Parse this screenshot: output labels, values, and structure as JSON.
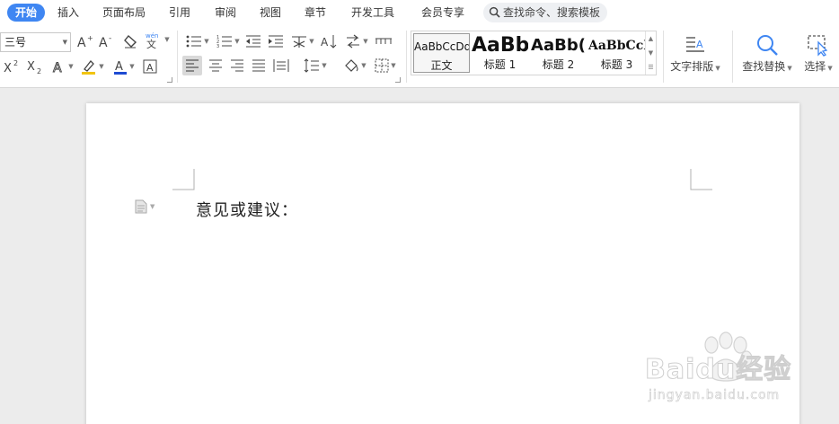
{
  "tabs": [
    {
      "label": "开始",
      "active": true
    },
    {
      "label": "插入"
    },
    {
      "label": "页面布局"
    },
    {
      "label": "引用"
    },
    {
      "label": "审阅"
    },
    {
      "label": "视图"
    },
    {
      "label": "章节"
    },
    {
      "label": "开发工具"
    },
    {
      "label": "会员专享"
    }
  ],
  "search": {
    "label": "查找命令、搜索模板"
  },
  "font": {
    "size": "三号"
  },
  "styles": [
    {
      "sample": "AaBbCcDd",
      "name": "正文",
      "selected": true
    },
    {
      "sample": "AaBb",
      "name": "标题 1"
    },
    {
      "sample": "AaBb(",
      "name": "标题 2"
    },
    {
      "sample": "AaBbCcI",
      "name": "标题 3"
    }
  ],
  "buttons": {
    "text_layout": "文字排版",
    "find_replace": "查找替换",
    "select": "选择"
  },
  "document": {
    "text": "意见或建议："
  },
  "watermark": {
    "brand": "Baidu经验",
    "url": "jingyan.baidu.com"
  },
  "colors": {
    "accent": "#3f86f2",
    "font_color_bar": "#1e4bd2",
    "highlight_bar": "#f1c40f"
  }
}
